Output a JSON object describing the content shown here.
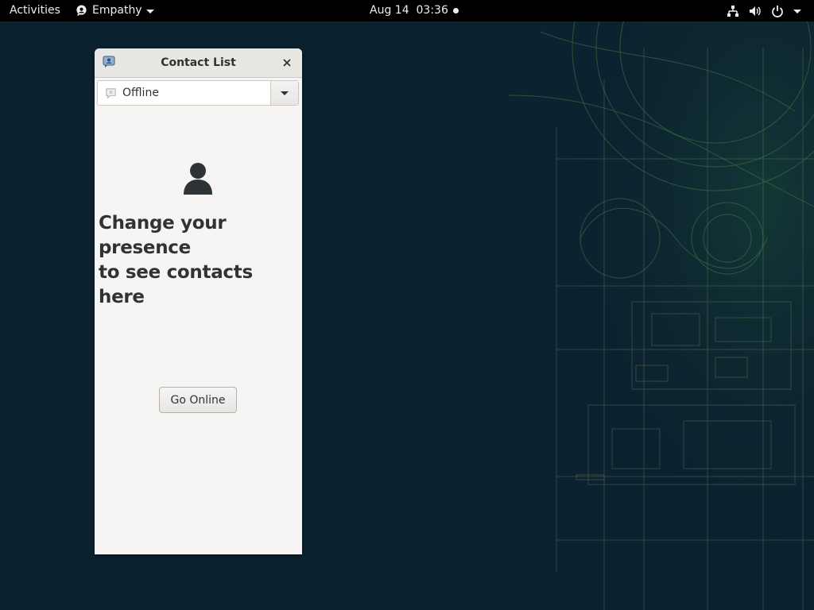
{
  "topbar": {
    "activities": "Activities",
    "app_name": "Empathy",
    "clock": "Aug 14  03:36",
    "tray_icons": [
      "network-icon",
      "volume-icon",
      "power-icon"
    ]
  },
  "window": {
    "title": "Contact List",
    "presence": {
      "value": "Offline",
      "icon": "offline-status-icon"
    },
    "empty_state": {
      "icon": "person-icon",
      "line1": "Change your presence",
      "line2": "to see contacts here"
    },
    "go_online_label": "Go Online"
  },
  "colors": {
    "desktop_bg": "#0b2230",
    "topbar_bg": "#000000",
    "window_bg": "#f6f5f4",
    "text": "#2e3436",
    "wallpaper_lines": "#4f9a4a"
  }
}
